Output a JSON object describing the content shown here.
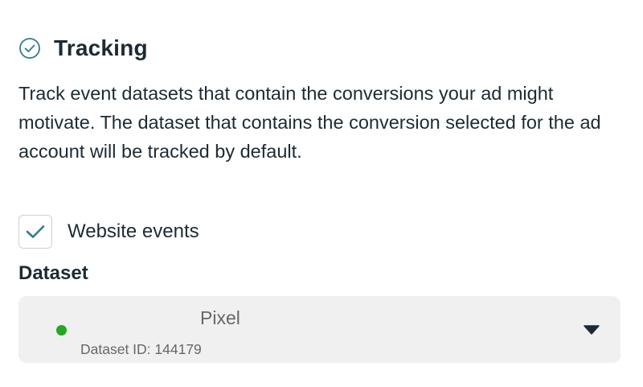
{
  "section": {
    "title": "Tracking",
    "icon": "check-circle-icon",
    "description": "Track event datasets that contain the conversions your ad might motivate. The dataset that contains the conversion selected for the ad account will be tracked by default."
  },
  "website_events": {
    "label": "Website events",
    "checked": true,
    "check_color": "#2f7d8c"
  },
  "dataset": {
    "label": "Dataset",
    "selected": {
      "name": "Pixel",
      "id_text": "Dataset ID: 144179",
      "status_color": "#22a822"
    },
    "caret_icon": "caret-down-icon"
  }
}
